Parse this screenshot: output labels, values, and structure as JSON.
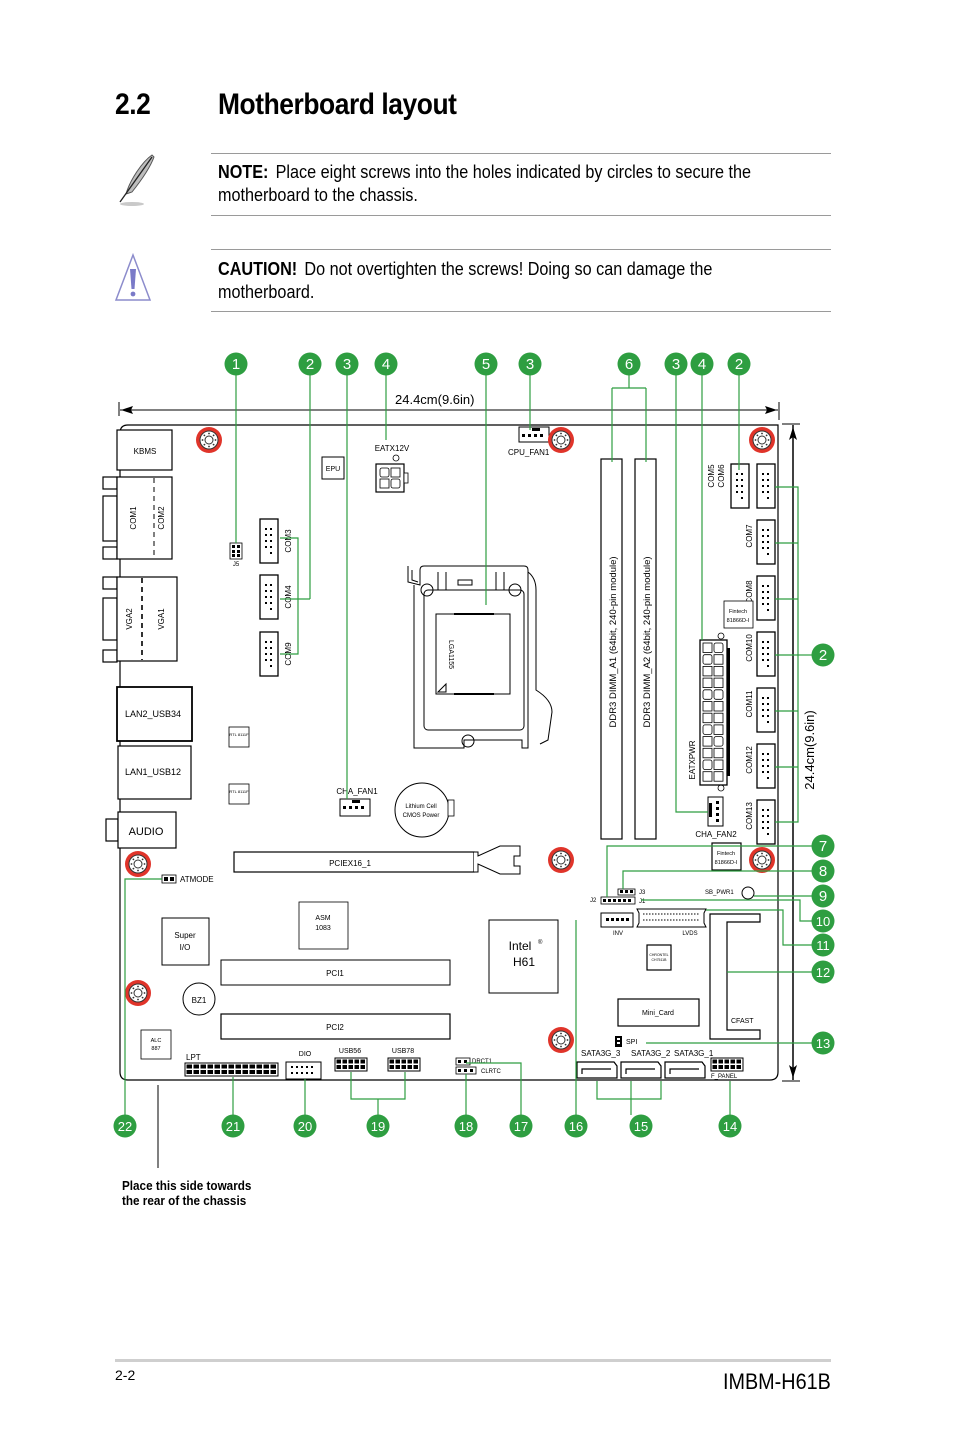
{
  "header": {
    "section_number": "2.2",
    "section_title": "Motherboard layout"
  },
  "note": {
    "icon": "feather-pen-icon",
    "label": "NOTE:",
    "text": "Place eight screws into the holes indicated by circles to secure the motherboard to the chassis.",
    "line1": "Place eight screws into the holes indicated by circles to secure the",
    "line2": "motherboard to the chassis."
  },
  "caution": {
    "icon": "warning-triangle-icon",
    "label": "CAUTION!",
    "line1": "Do not overtighten the screws! Doing so can damage the",
    "line2": "motherboard."
  },
  "diagram": {
    "width_label": "24.4cm(9.6in)",
    "height_label": "24.4cm(9.6in)",
    "rear_note_line1": "Place this side towards",
    "rear_note_line2": "the rear of the chassis",
    "callout_color": "#2e9e41",
    "screw_color": "#e0342a",
    "callouts_top": [
      "1",
      "2",
      "3",
      "4",
      "5",
      "3",
      "6",
      "3",
      "4",
      "2"
    ],
    "callouts_right": [
      "2",
      "7",
      "8",
      "9",
      "10",
      "11",
      "12",
      "13"
    ],
    "callouts_bottom": [
      "22",
      "21",
      "20",
      "19",
      "18",
      "17",
      "16",
      "15",
      "14"
    ],
    "components": {
      "kbms": "KBMS",
      "com1": "COM1",
      "com2": "COM2",
      "vga2": "VGA2",
      "vga1": "VGA1",
      "lan2": "LAN2_USB34",
      "lan1": "LAN1_USB12",
      "audio": "AUDIO",
      "rtl1": "RTL 8111F",
      "rtl2": "RTL 8111F",
      "j5": "J5",
      "com3": "COM3",
      "com4": "COM4",
      "com9": "COM9",
      "epu": "EPU",
      "eatx12v": "EATX12V",
      "cpu_fan": "CPU_FAN1",
      "socket": "LGA1155",
      "cha_fan1": "CHA_FAN1",
      "battery_l1": "Lithium Cell",
      "battery_l2": "CMOS Power",
      "dimm_a1": "DDR3 DIMM_A1 (64bit, 240-pin module)",
      "dimm_a2": "DDR3 DIMM_A2 (64bit, 240-pin module)",
      "com5": "COM5",
      "com6": "COM6",
      "com7": "COM7",
      "com8": "COM8",
      "com10": "COM10",
      "com11": "COM11",
      "com12": "COM12",
      "com13": "COM13",
      "fintech1_l1": "Fintech",
      "fintech1_l2": "81866D-I",
      "fintech2_l1": "Fintech",
      "fintech2_l2": "81866D-I",
      "eatxpwr": "EATXPWR",
      "cha_fan2": "CHA_FAN2",
      "pciex16": "PCIEX16_1",
      "atmode": "ATMODE",
      "asm_l1": "ASM",
      "asm_l2": "1083",
      "superio_l1": "Super",
      "superio_l2": "I/O",
      "pci1": "PCI1",
      "pci2": "PCI2",
      "bz1": "BZ1",
      "alc_l1": "ALC",
      "alc_l2": "887",
      "lpt": "LPT",
      "dio": "DIO",
      "usb56": "USB56",
      "usb78": "USB78",
      "drct1": "DRCT1",
      "clrtc": "CLRTC",
      "intel_l1": "Intel",
      "intel_reg": "®",
      "intel_l2": "H61",
      "j2": "J2",
      "j3": "J3",
      "j1": "J1",
      "sb_pwr1": "SB_PWR1",
      "inv": "INV",
      "lvds": "LVDS",
      "chrontel_l1": "CHRONTEL",
      "chrontel_l2": "CH7511B",
      "mini_card": "Mini_Card",
      "cfast": "CFAST",
      "spi": "SPI",
      "sata3": "SATA3G_3",
      "sata2": "SATA3G_2",
      "sata1": "SATA3G_1",
      "f_panel": "F_PANEL"
    }
  },
  "footer": {
    "page_number": "2-2",
    "model": "IMBM-H61B"
  }
}
